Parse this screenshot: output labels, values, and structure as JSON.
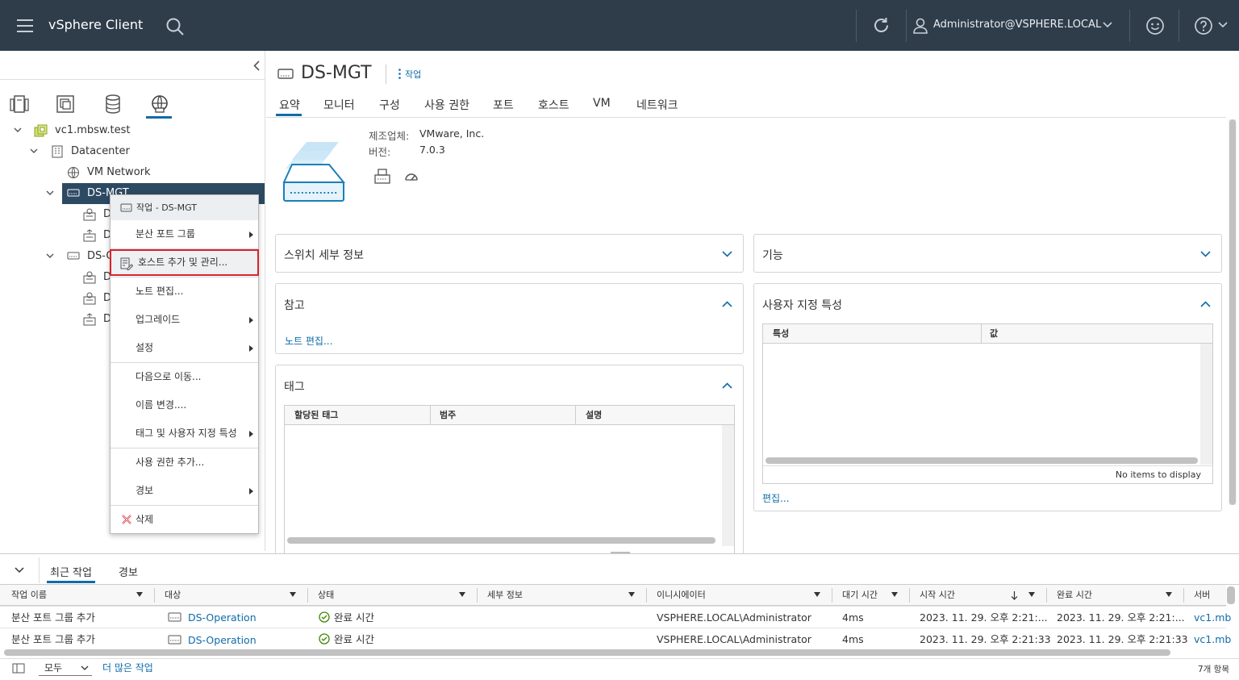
{
  "header": {
    "app_title": "vSphere Client",
    "user": "Administrator@VSPHERE.LOCAL"
  },
  "tree": {
    "items": [
      {
        "label": "vc1.mbsw.test"
      },
      {
        "label": "Datacenter"
      },
      {
        "label": "VM Network"
      },
      {
        "label": "DS-MGT"
      },
      {
        "label": "D"
      },
      {
        "label": "D"
      },
      {
        "label": "DS-O"
      },
      {
        "label": "D"
      },
      {
        "label": "D"
      },
      {
        "label": "D"
      }
    ]
  },
  "context_menu": {
    "header": "작업 - DS-MGT",
    "items": [
      {
        "label": "분산 포트 그룹",
        "submenu": true
      },
      {
        "label": "호스트 추가 및 관리...",
        "submenu": false
      },
      {
        "label": "노트 편집...",
        "submenu": false
      },
      {
        "label": "업그레이드",
        "submenu": true
      },
      {
        "label": "설정",
        "submenu": true
      },
      {
        "label": "다음으로 이동...",
        "submenu": false
      },
      {
        "label": "이름 변경....",
        "submenu": false
      },
      {
        "label": "태그 및 사용자 지정 특성",
        "submenu": true
      },
      {
        "label": "사용 권한 추가...",
        "submenu": false
      },
      {
        "label": "경보",
        "submenu": true
      },
      {
        "label": "삭제",
        "submenu": false
      }
    ]
  },
  "object": {
    "title": "DS-MGT",
    "actions": "작업",
    "tabs": [
      "요약",
      "모니터",
      "구성",
      "사용 권한",
      "포트",
      "호스트",
      "VM",
      "네트워크"
    ],
    "manufacturer_label": "제조업체:",
    "manufacturer_value": "VMware, Inc.",
    "version_label": "버전:",
    "version_value": "7.0.3"
  },
  "cards": {
    "switch_details": "스위치 세부 정보",
    "features": "기능",
    "notes": "참고",
    "notes_link": "노트 편집...",
    "custom_attrs": "사용자 지정 특성",
    "custom_cols": [
      "특성",
      "값"
    ],
    "custom_empty": "No items to display",
    "custom_edit": "편집...",
    "tags": "태그",
    "tag_cols": [
      "할당된 태그",
      "범주",
      "설명"
    ]
  },
  "bottom": {
    "tabs": [
      "최근 작업",
      "경보"
    ],
    "columns": [
      "작업 이름",
      "대상",
      "상태",
      "세부 정보",
      "이니시에이터",
      "대기 시간",
      "시작 시간",
      "완료 시간",
      "서버"
    ],
    "rows": [
      {
        "name": "분산 포트 그룹 추가",
        "target": "DS-Operation",
        "status": "완료 시간",
        "details": "",
        "initiator": "VSPHERE.LOCAL\\Administrator",
        "queued": "4ms",
        "start": "2023. 11. 29. 오후 2:21:...",
        "end": "2023. 11. 29. 오후 2:21:...",
        "server": "vc1.mb"
      },
      {
        "name": "분산 포트 그룹 추가",
        "target": "DS-Operation",
        "status": "완료 시간",
        "details": "",
        "initiator": "VSPHERE.LOCAL\\Administrator",
        "queued": "4ms",
        "start": "2023. 11. 29. 오후 2:21:33",
        "end": "2023. 11. 29. 오후 2:21:33",
        "server": "vc1.mb"
      }
    ],
    "filter": "모두",
    "more_tasks": "더 많은 작업",
    "count": "7개 항목"
  }
}
